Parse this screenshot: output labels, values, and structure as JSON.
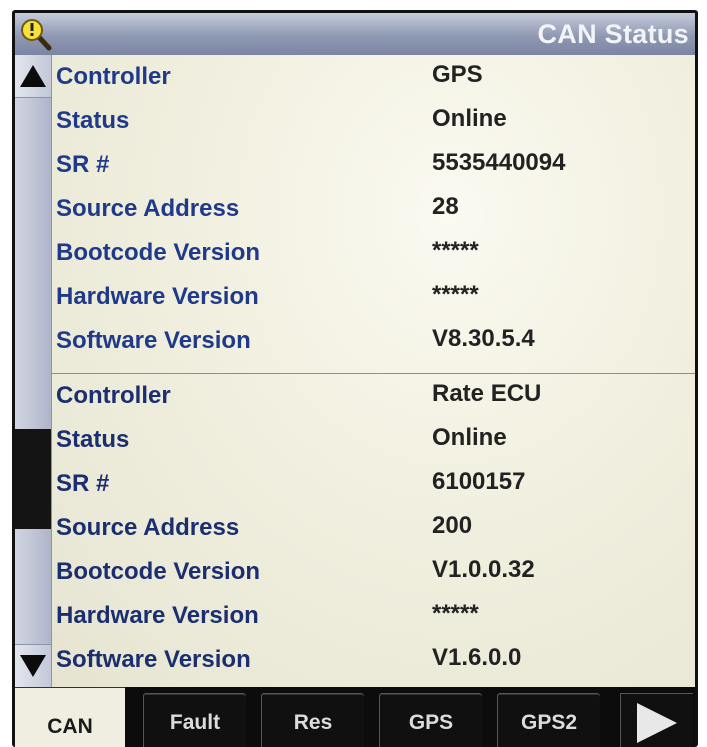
{
  "header": {
    "title": "CAN Status",
    "icon": "info-magnifier-icon"
  },
  "controllers": [
    {
      "rows": [
        {
          "label": "Controller",
          "value": "GPS"
        },
        {
          "label": "Status",
          "value": "Online"
        },
        {
          "label": "SR #",
          "value": "5535440094"
        },
        {
          "label": "Source Address",
          "value": "28"
        },
        {
          "label": "Bootcode Version",
          "value": "*****"
        },
        {
          "label": "Hardware Version",
          "value": "*****"
        },
        {
          "label": "Software Version",
          "value": "V8.30.5.4"
        }
      ]
    },
    {
      "rows": [
        {
          "label": "Controller",
          "value": "Rate ECU"
        },
        {
          "label": "Status",
          "value": "Online"
        },
        {
          "label": "SR #",
          "value": "6100157"
        },
        {
          "label": "Source Address",
          "value": "200"
        },
        {
          "label": "Bootcode Version",
          "value": "V1.0.0.32"
        },
        {
          "label": "Hardware Version",
          "value": "*****"
        },
        {
          "label": "Software Version",
          "value": "V1.6.0.0"
        }
      ]
    }
  ],
  "tabs": [
    {
      "label": "CAN",
      "active": true
    },
    {
      "label": "Fault",
      "active": false
    },
    {
      "label": "Res",
      "active": false
    },
    {
      "label": "GPS",
      "active": false
    },
    {
      "label": "GPS2",
      "active": false
    }
  ],
  "colors": {
    "title_bar": "#8f99b2",
    "label_text": "#1f3a8a",
    "value_text": "#222222",
    "screen_bg": "#ecebdb"
  }
}
